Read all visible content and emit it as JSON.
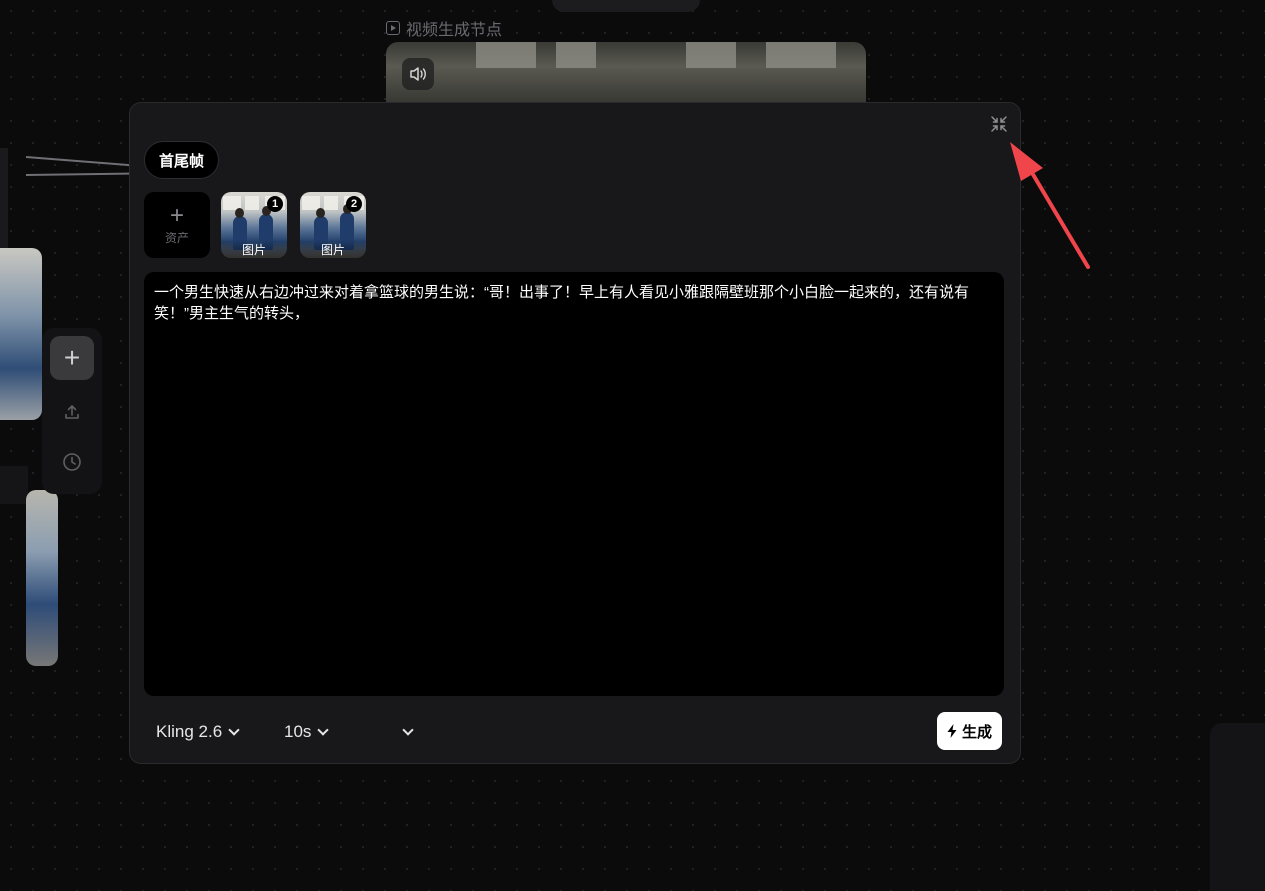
{
  "canvas": {
    "node_title": "视频生成节点",
    "speaker_icon": "speaker-icon",
    "side_toolbar": {
      "add": "plus-icon",
      "upload": "upload-icon",
      "history": "clock-icon"
    }
  },
  "editor": {
    "collapse_icon": "collapse-icon",
    "mode_label": "首尾帧",
    "asset_add_label": "资产",
    "thumbnails": [
      {
        "caption": "图片",
        "index": "1"
      },
      {
        "caption": "图片",
        "index": "2"
      }
    ],
    "prompt_text": "一个男生快速从右边冲过来对着拿篮球的男生说：“哥！出事了！早上有人看见小雅跟隔壁班那个小白脸一起来的，还有说有笑！”男主生气的转头，",
    "model_select": "Kling 2.6",
    "duration_select": "10s",
    "third_select": "",
    "generate_label": "生成"
  },
  "colors": {
    "background": "#0b0b0c",
    "panel": "#18181a",
    "input": "#000000",
    "accent_arrow": "#f0464b",
    "button_bg": "#ffffff"
  }
}
